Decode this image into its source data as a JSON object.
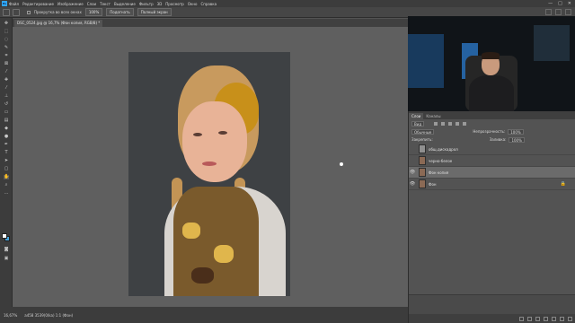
{
  "menubar": {
    "logo": "Ps",
    "items": [
      "Файл",
      "Редактирование",
      "Изображение",
      "Слои",
      "Текст",
      "Выделение",
      "Фильтр",
      "3D",
      "Просмотр",
      "Окно",
      "Справка"
    ],
    "win_min": "—",
    "win_max": "□",
    "win_close": "✕"
  },
  "options": {
    "scroll_all_label": "Прокрутка во всех окнах",
    "zoom_value": "100%",
    "fit_button": "Подогнать",
    "fullscreen_button": "Полный экран"
  },
  "document": {
    "tab_title": "DSC_0524.jpg @ 16,7% (Фон копия, RGB/8) *"
  },
  "status": {
    "zoom": "16,67%",
    "info": "a458 3539(0/ka) 1:1 (Фон)"
  },
  "panels": {
    "tabs": [
      "Слои",
      "Каналы"
    ],
    "filter_kind": "Вид",
    "blend_mode": "Обычные",
    "opacity_label": "Непрозрачность:",
    "opacity_value": "100%",
    "lock_label": "Закрепить:",
    "fill_label": "Заливка:",
    "fill_value": "100%"
  },
  "layers": [
    {
      "name": "общ.дискадрол",
      "visible": false,
      "selected": false,
      "thumb": "gray",
      "locked": false
    },
    {
      "name": "черно-белое",
      "visible": false,
      "selected": false,
      "thumb": "photo",
      "locked": false
    },
    {
      "name": "Фон копия",
      "visible": true,
      "selected": true,
      "thumb": "photo",
      "locked": false
    },
    {
      "name": "Фон",
      "visible": true,
      "selected": false,
      "thumb": "photo",
      "locked": true
    }
  ],
  "icons": {
    "eye": "👁",
    "lock": "🔒"
  }
}
